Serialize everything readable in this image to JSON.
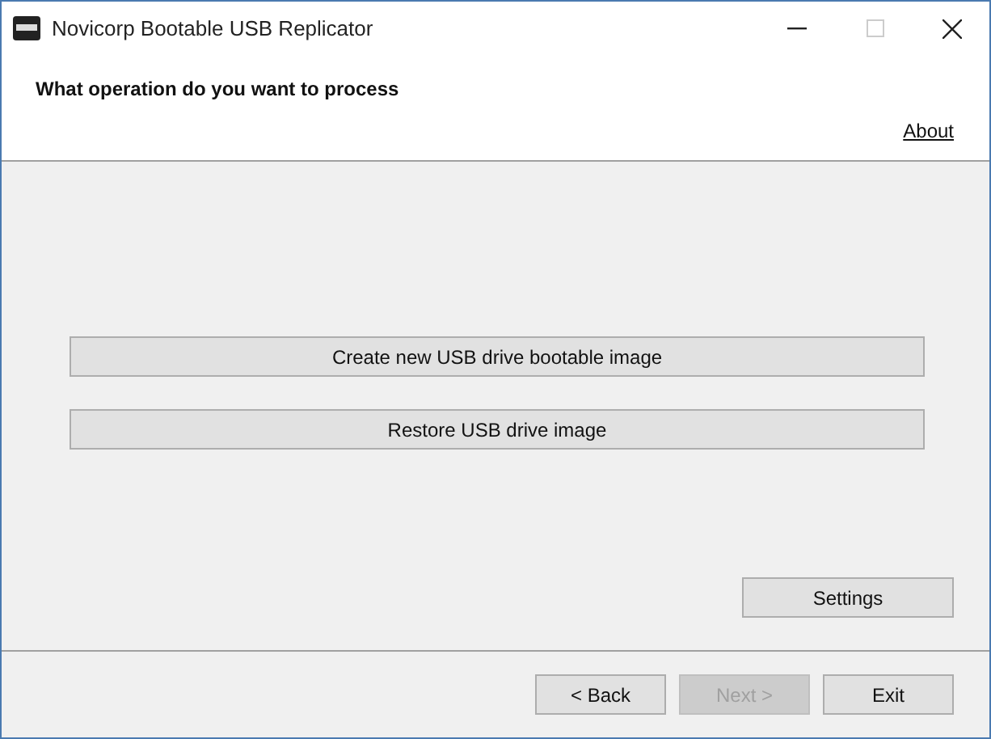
{
  "window": {
    "title": "Novicorp Bootable USB Replicator"
  },
  "header": {
    "heading": "What operation do you want to process",
    "link": "About"
  },
  "operations": [
    {
      "label": "Create new USB drive bootable image"
    },
    {
      "label": "Restore USB drive image"
    }
  ],
  "settings_button": {
    "label": "Settings"
  },
  "buttons": [
    {
      "label": "< Back",
      "disabled": false
    },
    {
      "label": "Next >",
      "disabled": true
    },
    {
      "label": "Exit",
      "disabled": false
    }
  ]
}
